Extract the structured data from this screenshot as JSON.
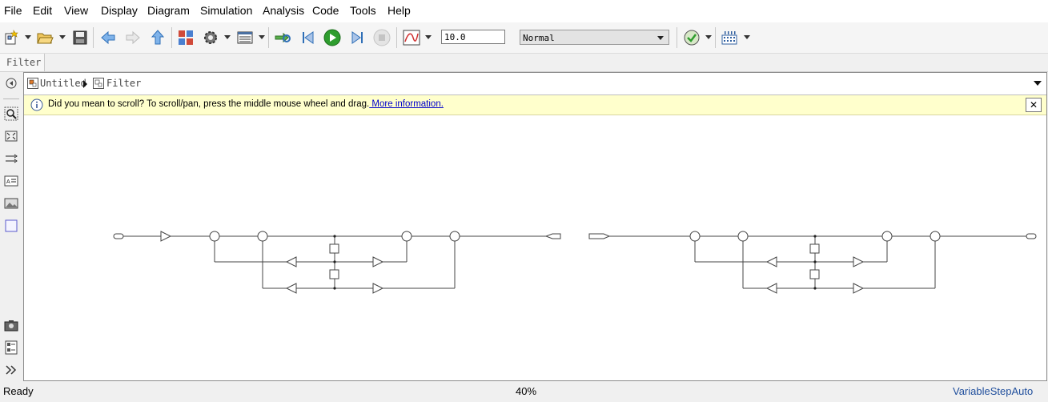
{
  "menu": [
    "File",
    "Edit",
    "View",
    "Display",
    "Diagram",
    "Simulation",
    "Analysis",
    "Code",
    "Tools",
    "Help"
  ],
  "toolbar": {
    "stop_time": "10.0",
    "sim_mode": "Normal",
    "icons": [
      "new-model-icon",
      "open-icon",
      "save-icon",
      "back-icon",
      "forward-icon",
      "up-icon",
      "library-browser-icon",
      "model-settings-icon",
      "model-explorer-icon",
      "update-diagram-icon",
      "step-back-icon",
      "run-icon",
      "step-forward-icon",
      "stop-icon",
      "scope-icon",
      "model-advisor-icon",
      "build-icon"
    ]
  },
  "tab": {
    "label": "Filter"
  },
  "breadcrumb": [
    "Untitled",
    "Filter"
  ],
  "notice": {
    "message": "Did you mean to scroll? To scroll/pan, press the middle mouse wheel and drag.",
    "link": " More information."
  },
  "status": {
    "left": "Ready",
    "zoom": "40%",
    "solver": "VariableStepAuto"
  },
  "colors": {
    "accent": "#0000cc",
    "notice_bg": "#ffffcc",
    "run_green": "#2e9d2e"
  }
}
